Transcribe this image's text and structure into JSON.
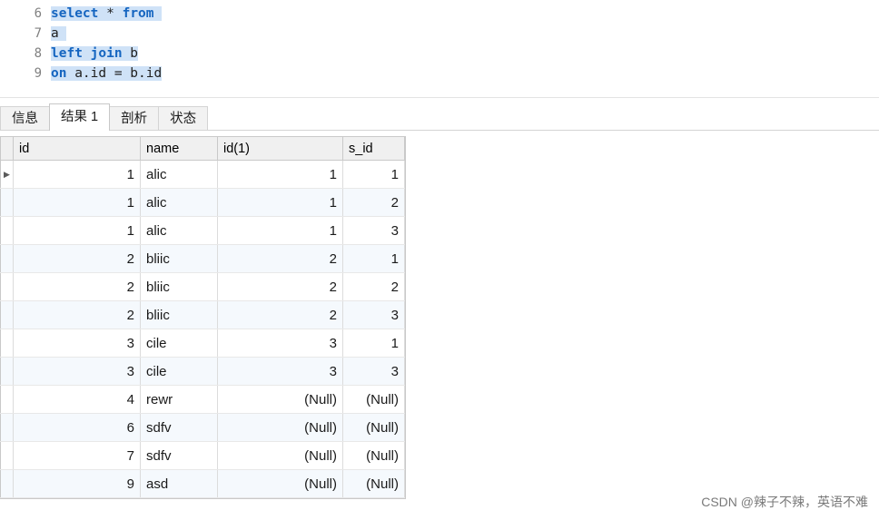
{
  "editor": {
    "lines": [
      {
        "number": "6",
        "tokens": [
          {
            "t": "select",
            "k": true,
            "sel": true
          },
          {
            "t": " * ",
            "k": false,
            "sel": true
          },
          {
            "t": "from",
            "k": true,
            "sel": true
          },
          {
            "t": " ",
            "k": false,
            "sel": true
          }
        ]
      },
      {
        "number": "7",
        "tokens": [
          {
            "t": "a",
            "k": false,
            "sel": true
          },
          {
            "t": " ",
            "k": false,
            "sel": true
          }
        ]
      },
      {
        "number": "8",
        "tokens": [
          {
            "t": "left join",
            "k": true,
            "sel": true
          },
          {
            "t": " b",
            "k": false,
            "sel": true
          }
        ]
      },
      {
        "number": "9",
        "tokens": [
          {
            "t": "on",
            "k": true,
            "sel": true
          },
          {
            "t": " a.id = b.id",
            "k": false,
            "sel": true
          }
        ]
      }
    ],
    "full_text": "select * from\na\nleft join b\non a.id = b.id"
  },
  "tabs": [
    {
      "label": "信息",
      "active": false
    },
    {
      "label": "结果 1",
      "active": true
    },
    {
      "label": "剖析",
      "active": false
    },
    {
      "label": "状态",
      "active": false
    }
  ],
  "grid": {
    "row_marker": "▶",
    "columns": [
      "id",
      "name",
      "id(1)",
      "s_id"
    ],
    "null_label": "(Null)",
    "rows": [
      {
        "current": true,
        "id": "1",
        "name": "alic",
        "id1": "1",
        "s_id": "1"
      },
      {
        "current": false,
        "id": "1",
        "name": "alic",
        "id1": "1",
        "s_id": "2"
      },
      {
        "current": false,
        "id": "1",
        "name": "alic",
        "id1": "1",
        "s_id": "3"
      },
      {
        "current": false,
        "id": "2",
        "name": "bliic",
        "id1": "2",
        "s_id": "1"
      },
      {
        "current": false,
        "id": "2",
        "name": "bliic",
        "id1": "2",
        "s_id": "2"
      },
      {
        "current": false,
        "id": "2",
        "name": "bliic",
        "id1": "2",
        "s_id": "3"
      },
      {
        "current": false,
        "id": "3",
        "name": "cile",
        "id1": "3",
        "s_id": "1"
      },
      {
        "current": false,
        "id": "3",
        "name": "cile",
        "id1": "3",
        "s_id": "3"
      },
      {
        "current": false,
        "id": "4",
        "name": "rewr",
        "id1": "(Null)",
        "s_id": "(Null)"
      },
      {
        "current": false,
        "id": "6",
        "name": "sdfv",
        "id1": "(Null)",
        "s_id": "(Null)"
      },
      {
        "current": false,
        "id": "7",
        "name": "sdfv",
        "id1": "(Null)",
        "s_id": "(Null)"
      },
      {
        "current": false,
        "id": "9",
        "name": "asd",
        "id1": "(Null)",
        "s_id": "(Null)"
      }
    ]
  },
  "watermark": {
    "text": "CSDN @辣子不辣，英语不难"
  }
}
